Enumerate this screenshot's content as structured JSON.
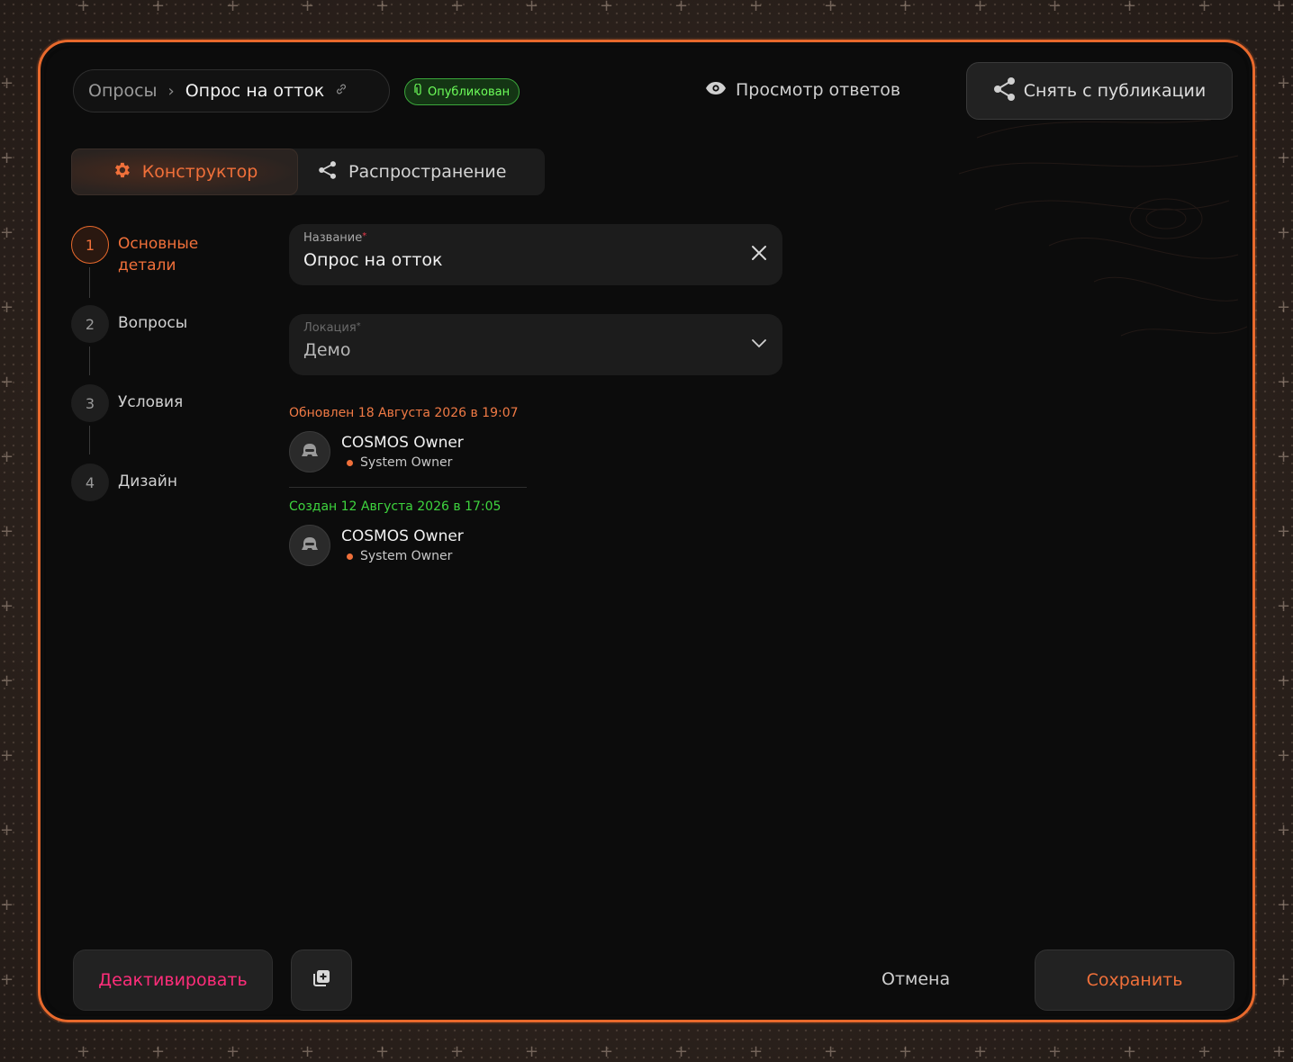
{
  "breadcrumb": {
    "root": "Опросы",
    "current": "Опрос на отток"
  },
  "status_badge": "Опубликован",
  "header": {
    "view_answers": "Просмотр ответов",
    "unpublish": "Снять с публикации"
  },
  "tabs": [
    {
      "label": "Конструктор",
      "active": true
    },
    {
      "label": "Распространение",
      "active": false
    }
  ],
  "steps": [
    {
      "number": "1",
      "label": "Основные детали",
      "active": true
    },
    {
      "number": "2",
      "label": "Вопросы",
      "active": false
    },
    {
      "number": "3",
      "label": "Условия",
      "active": false
    },
    {
      "number": "4",
      "label": "Дизайн",
      "active": false
    }
  ],
  "form": {
    "name": {
      "label": "Название",
      "required_mark": "*",
      "value": "Опрос на отток"
    },
    "location": {
      "label": "Локация",
      "required_mark": "*",
      "value": "Демо"
    }
  },
  "history": {
    "updated": {
      "text": "Обновлен 18 Августа 2026 в 19:07",
      "user": "COSMOS Owner",
      "role": "System Owner"
    },
    "created": {
      "text": "Создан 12 Августа 2026 в 17:05",
      "user": "COSMOS Owner",
      "role": "System Owner"
    }
  },
  "footer": {
    "deactivate": "Деактивировать",
    "cancel": "Отмена",
    "save": "Сохранить"
  },
  "colors": {
    "accent": "#e8692c",
    "success": "#3ed43e",
    "danger": "#ff2d7a"
  }
}
